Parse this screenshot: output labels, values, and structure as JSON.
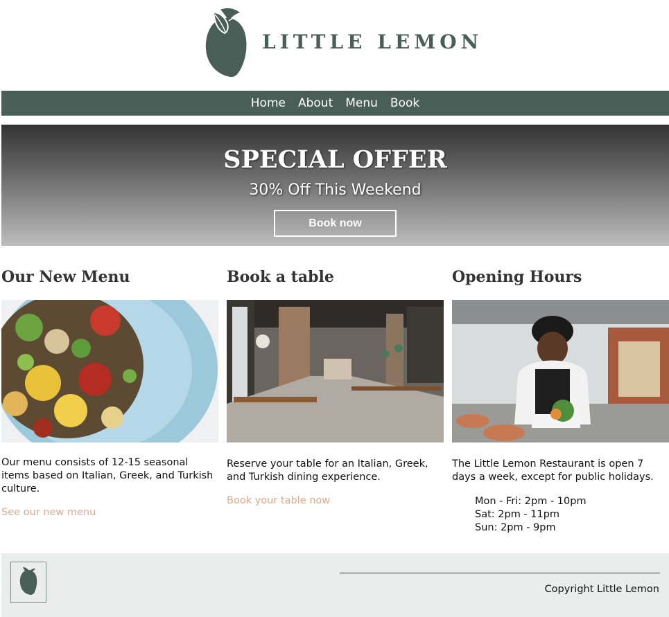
{
  "brand": {
    "name": "LITTLE LEMON",
    "color": "#495e57"
  },
  "nav": {
    "items": [
      {
        "label": "Home"
      },
      {
        "label": "About"
      },
      {
        "label": "Menu"
      },
      {
        "label": "Book"
      }
    ]
  },
  "hero": {
    "title": "SPECIAL OFFER",
    "subtitle": "30% Off This Weekend",
    "button": "Book now"
  },
  "columns": [
    {
      "heading": "Our New Menu",
      "image_icon": "salad-plate-image",
      "text": "Our menu consists of 12-15 seasonal items based on Italian, Greek, and Turkish culture.",
      "link": "See our new menu"
    },
    {
      "heading": "Book a table",
      "image_icon": "restaurant-interior-image",
      "text": "Reserve your table for an Italian, Greek, and Turkish dining experience.",
      "link": "Book your table now"
    },
    {
      "heading": "Opening Hours",
      "image_icon": "chef-cooking-image",
      "text": "The Little Lemon Restaurant is open 7 days a week, except for public holidays.",
      "hours": [
        "Mon - Fri: 2pm - 10pm",
        "Sat: 2pm - 11pm",
        "Sun: 2pm - 9pm"
      ]
    }
  ],
  "footer": {
    "copyright": "Copyright Little Lemon"
  },
  "colors": {
    "link": "#e0a98a",
    "footer_bg": "#ebeded"
  }
}
